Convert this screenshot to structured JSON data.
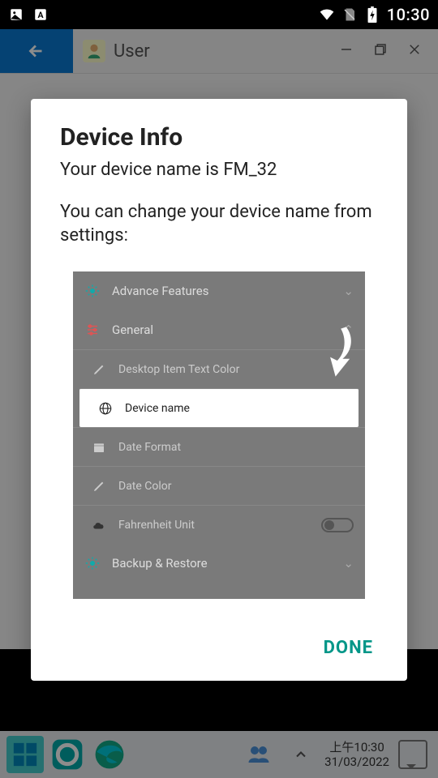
{
  "status": {
    "time": "10:30"
  },
  "header": {
    "title": "User"
  },
  "dialog": {
    "title": "Device Info",
    "line1": "Your device name is FM_32",
    "line2": "You can change your device name from settings:",
    "done": "DONE"
  },
  "settings_preview": {
    "rows": {
      "r0": "Advance Features",
      "r1": "General",
      "r2": "Desktop Item Text Color",
      "r3": "Device name",
      "r4": "Date Format",
      "r5": "Date Color",
      "r6": "Fahrenheit Unit",
      "r7": "Backup & Restore"
    }
  },
  "taskbar": {
    "time_top": "上午10:30",
    "time_bottom": "31/03/2022"
  }
}
